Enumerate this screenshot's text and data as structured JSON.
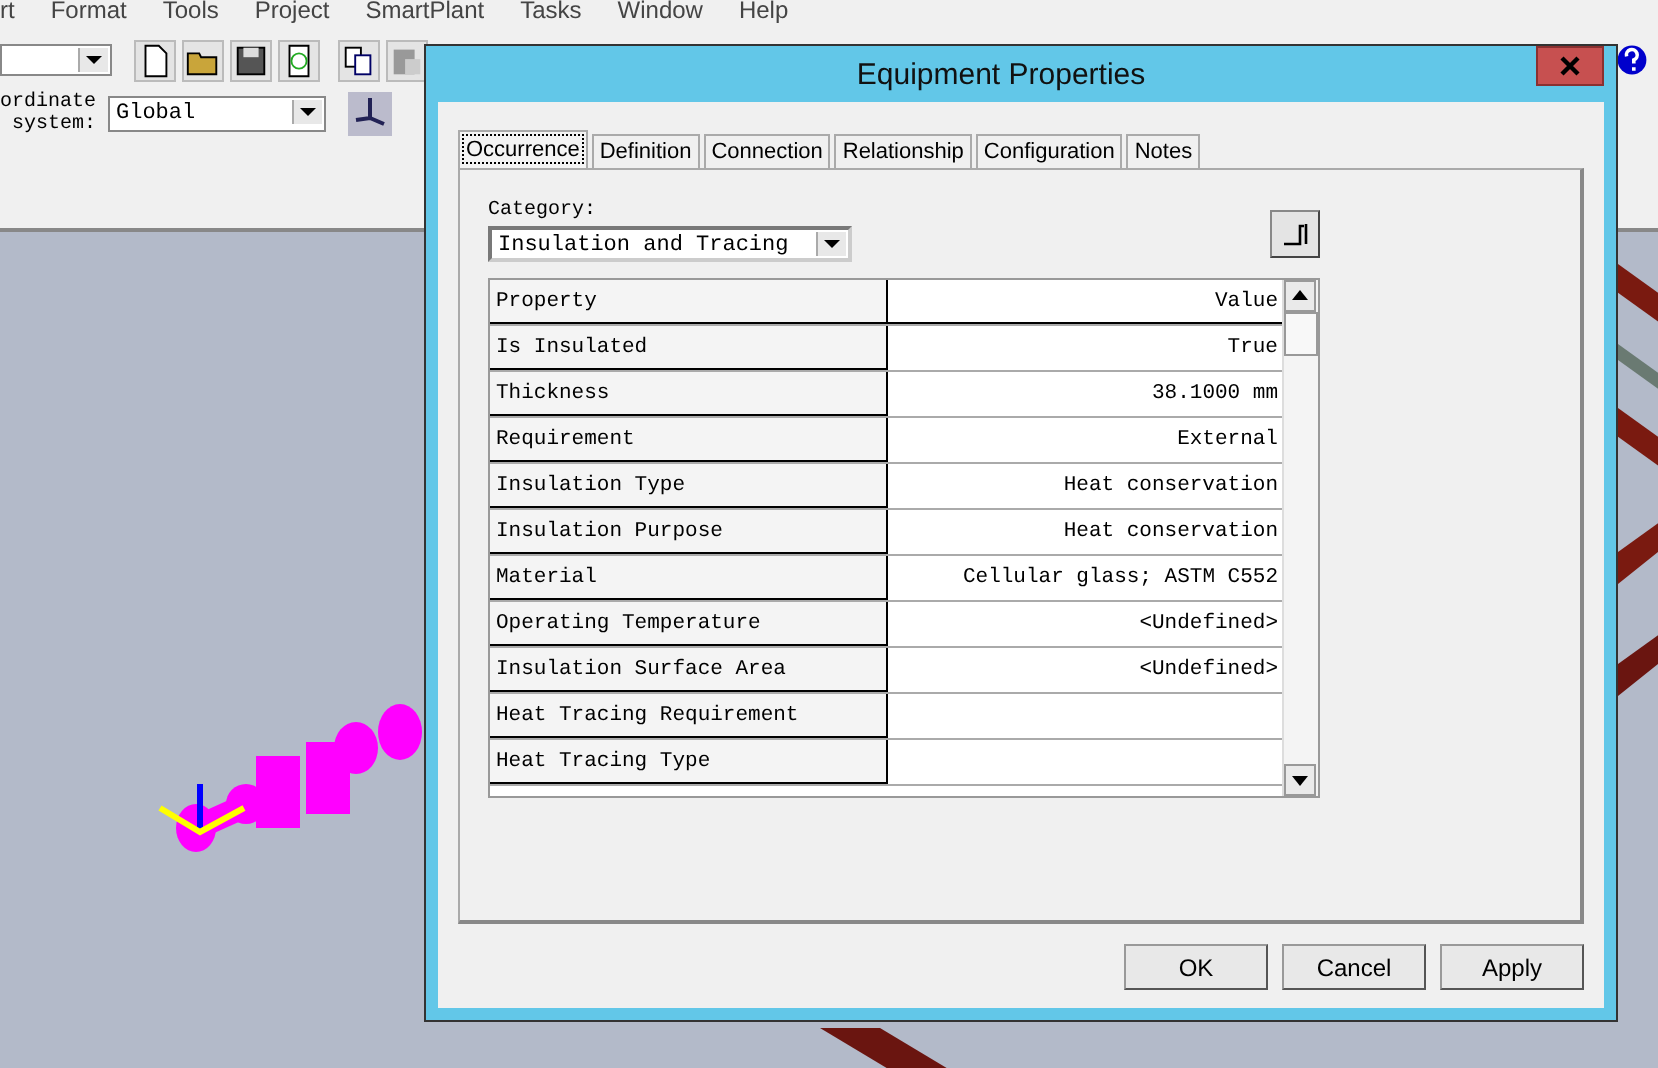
{
  "menu": [
    "rt",
    "Format",
    "Tools",
    "Project",
    "SmartPlant",
    "Tasks",
    "Window",
    "Help"
  ],
  "toolbar": {
    "coordinate_label": [
      "ordinate",
      "system:"
    ],
    "coordinate_system": "Global"
  },
  "dialog": {
    "title": "Equipment Properties",
    "tabs": [
      {
        "label": "Occurrence",
        "selected": true
      },
      {
        "label": "Definition",
        "selected": false
      },
      {
        "label": "Connection",
        "selected": false
      },
      {
        "label": "Relationship",
        "selected": false
      },
      {
        "label": "Configuration",
        "selected": false
      },
      {
        "label": "Notes",
        "selected": false
      }
    ],
    "category_label": "Category:",
    "category": "Insulation and Tracing",
    "grid": {
      "columns": [
        "Property",
        "Value"
      ],
      "rows": [
        {
          "property": "Is Insulated",
          "value": "True"
        },
        {
          "property": "Thickness",
          "value": "38.1000 mm"
        },
        {
          "property": "Requirement",
          "value": "External"
        },
        {
          "property": "Insulation Type",
          "value": "Heat conservation"
        },
        {
          "property": "Insulation Purpose",
          "value": "Heat conservation"
        },
        {
          "property": "Material",
          "value": "Cellular glass; ASTM C552"
        },
        {
          "property": "Operating Temperature",
          "value": "<Undefined>"
        },
        {
          "property": "Insulation Surface Area",
          "value": "<Undefined>"
        },
        {
          "property": "Heat Tracing Requirement",
          "value": ""
        },
        {
          "property": "Heat Tracing Type",
          "value": ""
        }
      ]
    },
    "buttons": [
      "OK",
      "Cancel",
      "Apply"
    ]
  }
}
